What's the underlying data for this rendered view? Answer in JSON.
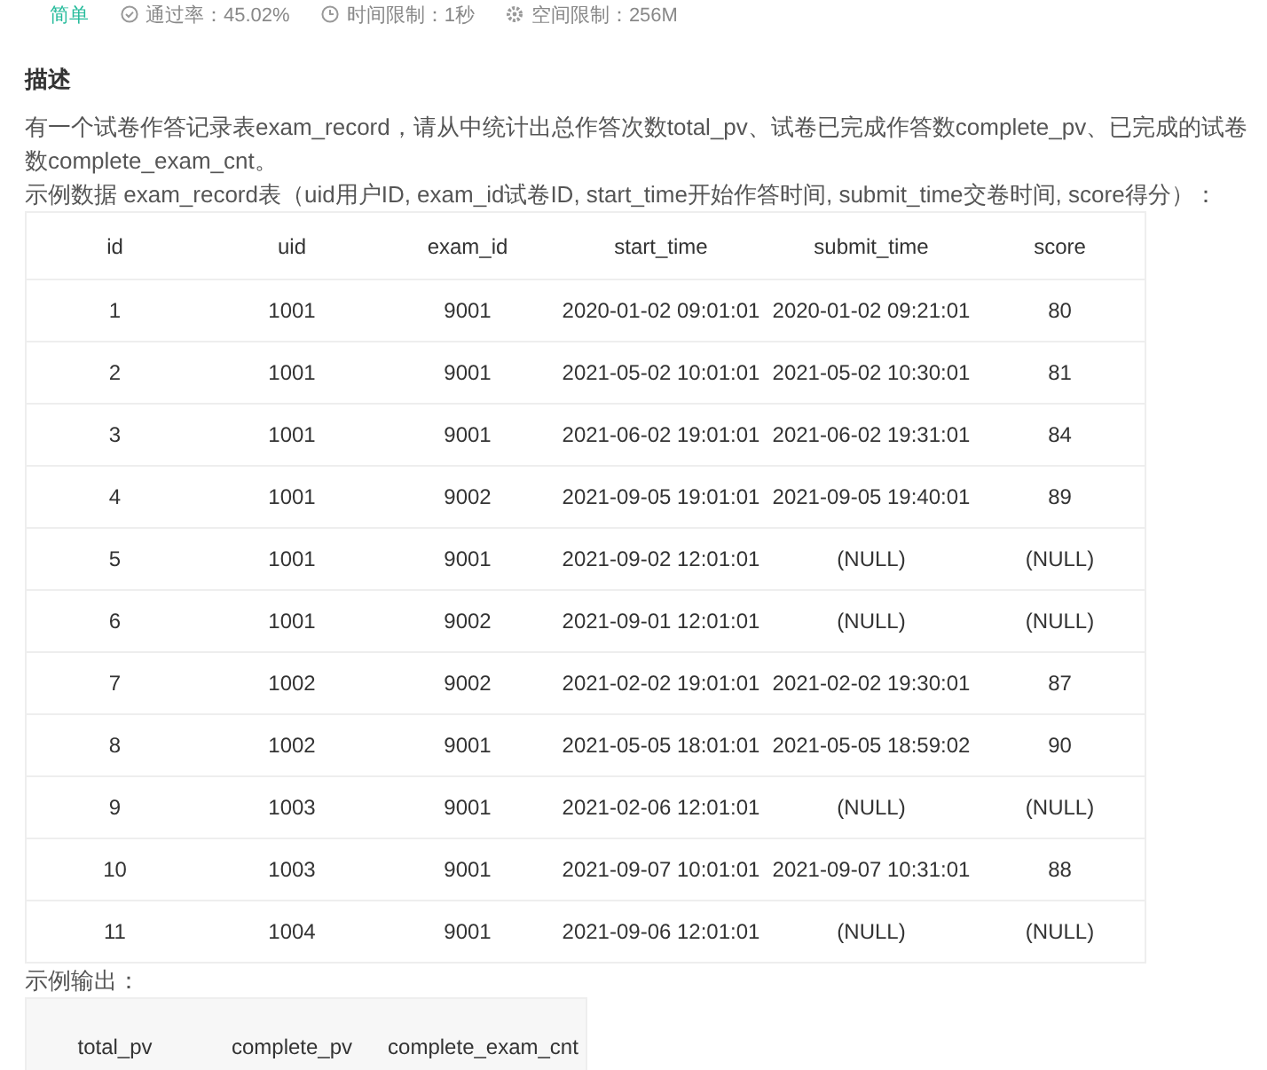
{
  "meta": {
    "difficulty": "简单",
    "pass_rate": "通过率：45.02%",
    "time_limit": "时间限制：1秒",
    "space_limit": "空间限制：256M"
  },
  "description": {
    "title": "描述",
    "paragraph": "有一个试卷作答记录表exam_record，请从中统计出总作答次数total_pv、试卷已完成作答数complete_pv、已完成的试卷数complete_exam_cnt。",
    "sample_label": "示例数据 exam_record表（uid用户ID, exam_id试卷ID, start_time开始作答时间, submit_time交卷时间, score得分）："
  },
  "table": {
    "columns": [
      "id",
      "uid",
      "exam_id",
      "start_time",
      "submit_time",
      "score"
    ],
    "rows": [
      [
        "1",
        "1001",
        "9001",
        "2020-01-02 09:01:01",
        "2020-01-02 09:21:01",
        "80"
      ],
      [
        "2",
        "1001",
        "9001",
        "2021-05-02 10:01:01",
        "2021-05-02 10:30:01",
        "81"
      ],
      [
        "3",
        "1001",
        "9001",
        "2021-06-02 19:01:01",
        "2021-06-02 19:31:01",
        "84"
      ],
      [
        "4",
        "1001",
        "9002",
        "2021-09-05 19:01:01",
        "2021-09-05 19:40:01",
        "89"
      ],
      [
        "5",
        "1001",
        "9001",
        "2021-09-02 12:01:01",
        "(NULL)",
        "(NULL)"
      ],
      [
        "6",
        "1001",
        "9002",
        "2021-09-01 12:01:01",
        "(NULL)",
        "(NULL)"
      ],
      [
        "7",
        "1002",
        "9002",
        "2021-02-02 19:01:01",
        "2021-02-02 19:30:01",
        "87"
      ],
      [
        "8",
        "1002",
        "9001",
        "2021-05-05 18:01:01",
        "2021-05-05 18:59:02",
        "90"
      ],
      [
        "9",
        "1003",
        "9001",
        "2021-02-06 12:01:01",
        "(NULL)",
        "(NULL)"
      ],
      [
        "10",
        "1003",
        "9001",
        "2021-09-07 10:01:01",
        "2021-09-07 10:31:01",
        "88"
      ],
      [
        "11",
        "1004",
        "9001",
        "2021-09-06 12:01:01",
        "(NULL)",
        "(NULL)"
      ]
    ]
  },
  "output_label": "示例输出：",
  "output_table": {
    "columns": [
      "total_pv",
      "complete_pv",
      "complete_exam_cnt"
    ]
  }
}
